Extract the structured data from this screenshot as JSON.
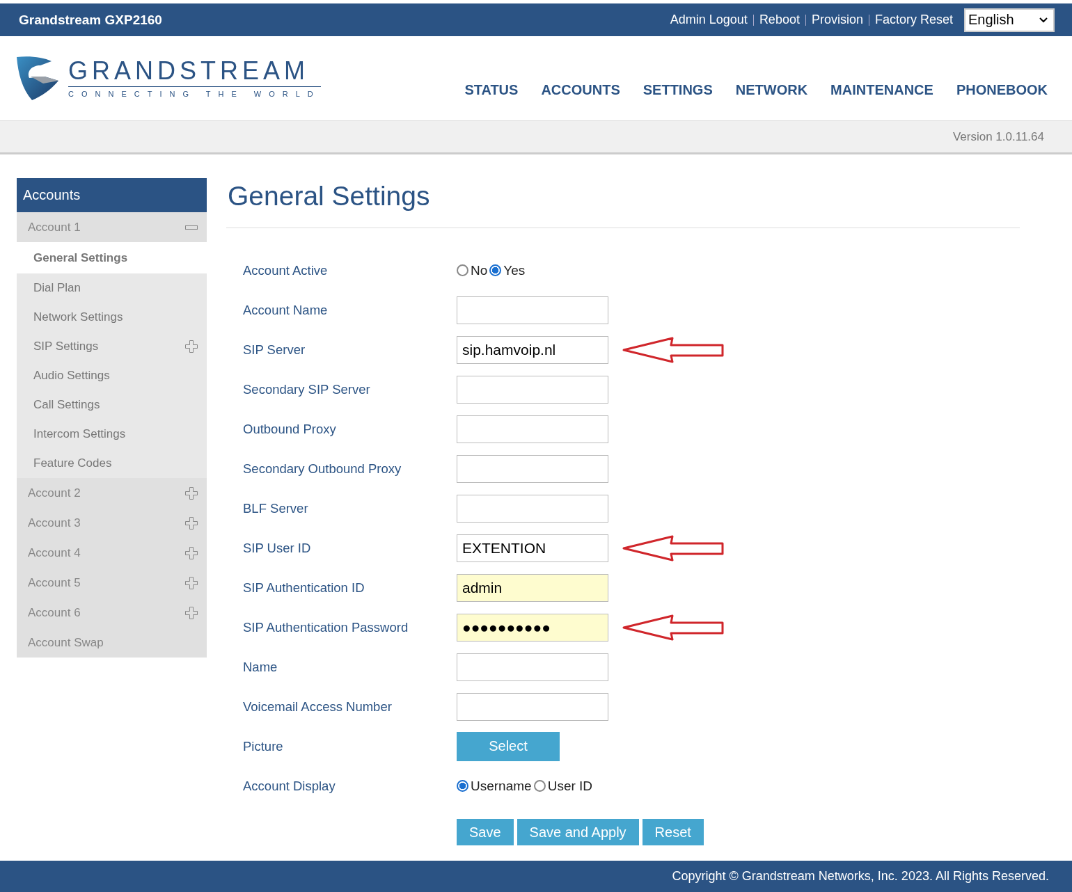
{
  "top_bar": {
    "title": "Grandstream GXP2160",
    "links": [
      "Admin Logout",
      "Reboot",
      "Provision",
      "Factory Reset"
    ],
    "language": "English"
  },
  "logo": {
    "name": "GRANDSTREAM",
    "tagline": "CONNECTING THE WORLD"
  },
  "nav": [
    {
      "label": "STATUS"
    },
    {
      "label": "ACCOUNTS"
    },
    {
      "label": "SETTINGS"
    },
    {
      "label": "NETWORK"
    },
    {
      "label": "MAINTENANCE"
    },
    {
      "label": "PHONEBOOK"
    }
  ],
  "version": "Version 1.0.11.64",
  "sidebar": {
    "title": "Accounts",
    "items": [
      {
        "label": "Account 1",
        "kind": "expandable",
        "expanded": true,
        "children": [
          {
            "label": "General Settings",
            "selected": true,
            "kind": "plain"
          },
          {
            "label": "Dial Plan",
            "selected": false,
            "kind": "plain"
          },
          {
            "label": "Network Settings",
            "selected": false,
            "kind": "plain"
          },
          {
            "label": "SIP Settings",
            "selected": false,
            "kind": "expandable",
            "expanded": false
          },
          {
            "label": "Audio Settings",
            "selected": false,
            "kind": "plain"
          },
          {
            "label": "Call Settings",
            "selected": false,
            "kind": "plain"
          },
          {
            "label": "Intercom Settings",
            "selected": false,
            "kind": "plain"
          },
          {
            "label": "Feature Codes",
            "selected": false,
            "kind": "plain"
          }
        ]
      },
      {
        "label": "Account 2",
        "kind": "expandable",
        "expanded": false
      },
      {
        "label": "Account 3",
        "kind": "expandable",
        "expanded": false
      },
      {
        "label": "Account 4",
        "kind": "expandable",
        "expanded": false
      },
      {
        "label": "Account 5",
        "kind": "expandable",
        "expanded": false
      },
      {
        "label": "Account 6",
        "kind": "expandable",
        "expanded": false
      },
      {
        "label": "Account Swap",
        "kind": "plain"
      }
    ]
  },
  "page_title": "General Settings",
  "fields": [
    {
      "label": "Account Active",
      "kind": "radio",
      "options": [
        {
          "label": "No",
          "selected": false
        },
        {
          "label": "Yes",
          "selected": true
        }
      ]
    },
    {
      "label": "Account Name",
      "kind": "text",
      "autofilled": false,
      "arrow": false
    },
    {
      "label": "SIP Server",
      "kind": "text",
      "value": "sip.hamvoip.nl",
      "autofilled": false,
      "arrow": true
    },
    {
      "label": "Secondary SIP Server",
      "kind": "text",
      "autofilled": false,
      "arrow": false
    },
    {
      "label": "Outbound Proxy",
      "kind": "text",
      "autofilled": false,
      "arrow": false
    },
    {
      "label": "Secondary Outbound Proxy",
      "kind": "text",
      "autofilled": false,
      "arrow": false
    },
    {
      "label": "BLF Server",
      "kind": "text",
      "autofilled": false,
      "arrow": false
    },
    {
      "label": "SIP User ID",
      "kind": "text",
      "value": "EXTENTION",
      "autofilled": false,
      "arrow": true
    },
    {
      "label": "SIP Authentication ID",
      "kind": "text",
      "value": "admin",
      "autofilled": true,
      "arrow": false
    },
    {
      "label": "SIP Authentication Password",
      "kind": "text",
      "value": "●●●●●●●●●●",
      "autofilled": true,
      "arrow": true
    },
    {
      "label": "Name",
      "kind": "text",
      "autofilled": false,
      "arrow": false
    },
    {
      "label": "Voicemail Access Number",
      "kind": "text",
      "autofilled": false,
      "arrow": false
    },
    {
      "label": "Picture",
      "kind": "button",
      "button": "Select"
    },
    {
      "label": "Account Display",
      "kind": "radio",
      "options": [
        {
          "label": "Username",
          "selected": true
        },
        {
          "label": "User ID",
          "selected": false
        }
      ]
    }
  ],
  "actions": [
    "Save",
    "Save and Apply",
    "Reset"
  ],
  "footer": "Copyright © Grandstream Networks, Inc. 2023. All Rights Reserved."
}
